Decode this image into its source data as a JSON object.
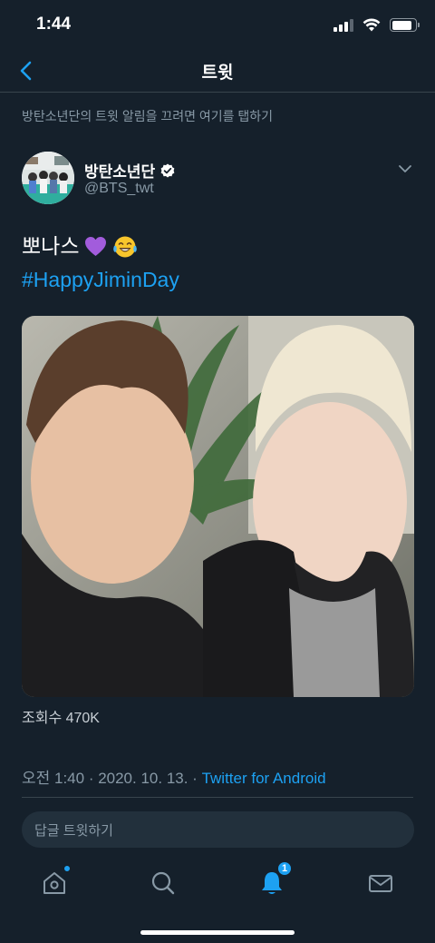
{
  "status_bar": {
    "time": "1:44",
    "signal_bars": 3,
    "battery_level": 0.85
  },
  "nav": {
    "title": "트윗",
    "back_icon": "chevron-left-icon"
  },
  "notification_banner": "방탄소년단의 트윗 알림을 끄려면 여기를 탭하기",
  "tweet": {
    "author_name": "방탄소년단",
    "verified": true,
    "handle": "@BTS_twt",
    "text_line1": "뽀나스",
    "emojis": [
      "purple-heart-icon",
      "tears-of-joy-icon"
    ],
    "hashtag": "#HappyJiminDay",
    "views": "조회수 470K",
    "timestamp": "오전 1:40 · 2020. 10. 13. · ",
    "source": "Twitter for Android"
  },
  "reply": {
    "placeholder": "답글 트윗하기"
  },
  "tabs": [
    {
      "name": "home",
      "icon": "home-icon",
      "has_dot": true
    },
    {
      "name": "search",
      "icon": "search-icon"
    },
    {
      "name": "notifications",
      "icon": "bell-icon",
      "badge": "1"
    },
    {
      "name": "messages",
      "icon": "envelope-icon"
    }
  ],
  "colors": {
    "background": "#15202b",
    "accent": "#1da1f2",
    "secondary_text": "#8899a6",
    "divider": "#38444d"
  }
}
